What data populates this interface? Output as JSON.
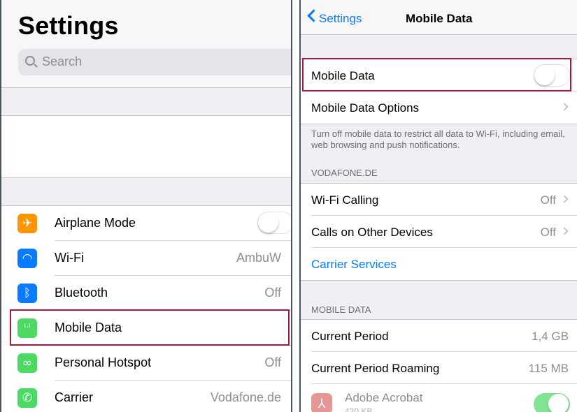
{
  "left": {
    "title": "Settings",
    "search_placeholder": "Search",
    "rows": [
      {
        "label": "Airplane Mode",
        "value": "",
        "icon": "airplane-icon",
        "color": "#ff9500",
        "glyph": "✈"
      },
      {
        "label": "Wi-Fi",
        "value": "AmbuW",
        "icon": "wifi-icon",
        "color": "#0a7aff",
        "glyph": "◠"
      },
      {
        "label": "Bluetooth",
        "value": "Off",
        "icon": "bluetooth-icon",
        "color": "#0a7aff",
        "glyph": "ᛒ"
      },
      {
        "label": "Mobile Data",
        "value": "",
        "icon": "antenna-icon",
        "color": "#4cd964",
        "glyph": "⁽ᐧ⁾"
      },
      {
        "label": "Personal Hotspot",
        "value": "Off",
        "icon": "hotspot-icon",
        "color": "#4cd964",
        "glyph": "∞"
      },
      {
        "label": "Carrier",
        "value": "Vodafone.de",
        "icon": "phone-icon",
        "color": "#4cd964",
        "glyph": "✆"
      }
    ]
  },
  "right": {
    "back_label": "Settings",
    "nav_title": "Mobile Data",
    "mobile_data_label": "Mobile Data",
    "mobile_data_options_label": "Mobile Data Options",
    "note": "Turn off mobile data to restrict all data to Wi-Fi, including email, web browsing and push notifications.",
    "carrier_header": "VODAFONE.DE",
    "wifi_calling_label": "Wi-Fi Calling",
    "wifi_calling_value": "Off",
    "calls_other_label": "Calls on Other Devices",
    "calls_other_value": "Off",
    "carrier_services_label": "Carrier Services",
    "usage_header": "MOBILE DATA",
    "current_period_label": "Current Period",
    "current_period_value": "1,4 GB",
    "roaming_label": "Current Period Roaming",
    "roaming_value": "115 MB",
    "app_name": "Adobe Acrobat",
    "app_size": "420 KB"
  },
  "colors": {
    "accent": "#0a7aff",
    "highlight": "#a8193e",
    "toggle_on": "#4cd964"
  }
}
